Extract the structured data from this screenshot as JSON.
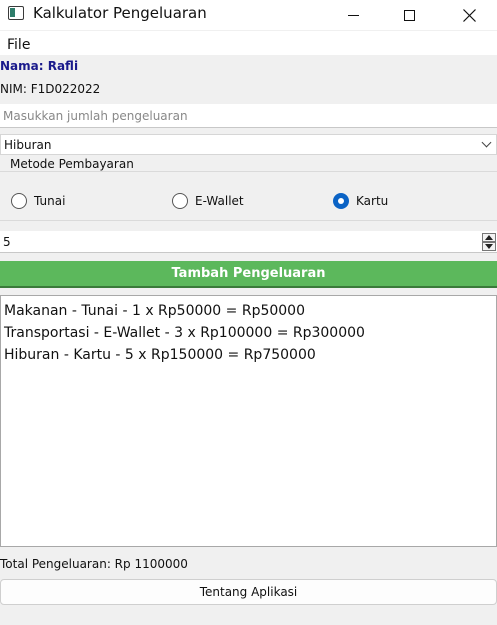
{
  "window": {
    "title": "Kalkulator Pengeluaran",
    "icon": "app-window-icon"
  },
  "menu": {
    "file": "File"
  },
  "user": {
    "name": "Nama: Rafli",
    "nim": "NIM: F1D022022"
  },
  "form": {
    "amount_placeholder": "Masukkan jumlah pengeluaran",
    "amount_value": "",
    "category_selected": "Hiburan",
    "payment_group_title": "Metode Pembayaran",
    "payment_options": [
      "Tunai",
      "E-Wallet",
      "Kartu"
    ],
    "payment_selected": "Kartu",
    "quantity": "5",
    "add_button": "Tambah Pengeluaran"
  },
  "expenses": [
    "Makanan - Tunai - 1 x Rp50000 = Rp50000",
    "Transportasi - E-Wallet - 3 x Rp100000 = Rp300000",
    "Hiburan - Kartu - 5 x Rp150000 = Rp750000"
  ],
  "total": "Total Pengeluaran: Rp 1100000",
  "about_button": "Tentang Aplikasi",
  "colors": {
    "accent_green": "#5cb85c",
    "name_blue": "#1a1a8c",
    "radio_selected": "#0b63c5"
  }
}
